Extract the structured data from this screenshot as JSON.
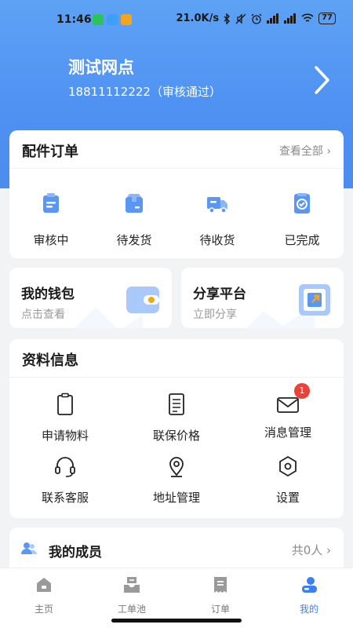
{
  "status_bar": {
    "time": "11:46",
    "network_speed": "21.0K/s",
    "battery": "77",
    "icons": [
      "wechat-icon",
      "cloud-icon",
      "mail-icon",
      "bluetooth-icon",
      "mute-icon",
      "alarm-icon",
      "signal-icon",
      "signal-icon",
      "wifi-icon",
      "battery-icon"
    ]
  },
  "header": {
    "shop_name": "测试网点",
    "phone_status": "18811112222（审核通过）"
  },
  "orders": {
    "title": "配件订单",
    "view_all": "查看全部 ›",
    "items": [
      {
        "label": "审核中",
        "icon": "clipboard-icon"
      },
      {
        "label": "待发货",
        "icon": "package-icon"
      },
      {
        "label": "待收货",
        "icon": "truck-icon"
      },
      {
        "label": "已完成",
        "icon": "check-document-icon"
      }
    ]
  },
  "wallet": {
    "title": "我的钱包",
    "subtitle": "点击查看",
    "icon": "wallet-icon"
  },
  "share": {
    "title": "分享平台",
    "subtitle": "立即分享",
    "icon": "share-icon"
  },
  "info": {
    "title": "资料信息",
    "items": [
      {
        "label": "申请物料",
        "icon": "clipboard-outline-icon"
      },
      {
        "label": "联保价格",
        "icon": "document-outline-icon"
      },
      {
        "label": "消息管理",
        "icon": "envelope-icon",
        "badge": "1"
      },
      {
        "label": "联系客服",
        "icon": "headset-icon"
      },
      {
        "label": "地址管理",
        "icon": "location-pin-icon"
      },
      {
        "label": "设置",
        "icon": "settings-hexagon-icon"
      }
    ]
  },
  "members": {
    "title": "我的成员",
    "count": "共0人 ›",
    "icon": "people-icon"
  },
  "tabbar": [
    {
      "label": "主页",
      "icon": "home-icon",
      "active": false
    },
    {
      "label": "工单池",
      "icon": "inbox-icon",
      "active": false
    },
    {
      "label": "订单",
      "icon": "receipt-icon",
      "active": false
    },
    {
      "label": "我的",
      "icon": "profile-icon",
      "active": true
    }
  ],
  "colors": {
    "header_blue": "#4f92f2",
    "accent_blue": "#3b7ff0",
    "badge_red": "#e9423a",
    "icon_blue": "#5c96f4"
  }
}
